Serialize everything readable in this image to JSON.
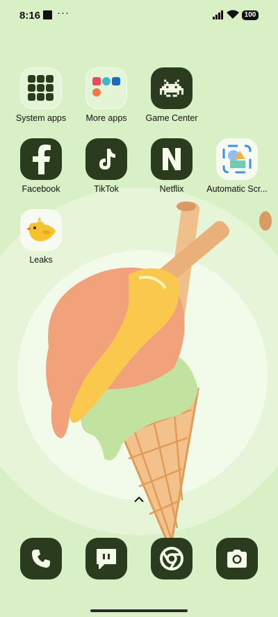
{
  "status": {
    "time": "8:16",
    "dots": "···",
    "battery": "100"
  },
  "apps": [
    {
      "label": "System apps",
      "icon": "folder-icon"
    },
    {
      "label": "More apps",
      "icon": "folder-icon"
    },
    {
      "label": "Game Center",
      "icon": "space-invader-icon"
    },
    {
      "label": "Facebook",
      "icon": "facebook-icon"
    },
    {
      "label": "TikTok",
      "icon": "music-note-icon"
    },
    {
      "label": "Netflix",
      "icon": "n-letter-icon"
    },
    {
      "label": "Automatic Scr...",
      "icon": "screenshot-shapes-icon"
    },
    {
      "label": "Leaks",
      "icon": "bird-icon"
    }
  ],
  "dock": [
    {
      "icon": "phone-icon"
    },
    {
      "icon": "messages-icon"
    },
    {
      "icon": "chrome-icon"
    },
    {
      "icon": "camera-icon"
    }
  ],
  "colors": {
    "wallpaper": "#d9efc6",
    "icon_bg": "#2b3c1e"
  }
}
